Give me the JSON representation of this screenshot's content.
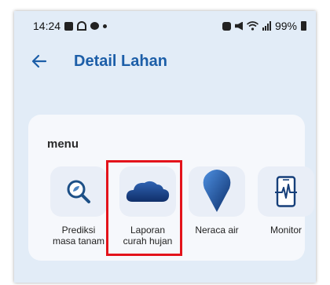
{
  "status_bar": {
    "time": "14:24",
    "battery": "99%"
  },
  "header": {
    "title": "Detail Lahan"
  },
  "menu": {
    "title": "menu",
    "items": [
      {
        "label": "Prediksi\nmasa tanam",
        "icon": "magnifier-leaf-icon"
      },
      {
        "label": "Laporan\ncurah hujan",
        "icon": "cloud-icon"
      },
      {
        "label": "Neraca air",
        "icon": "water-drop-icon"
      },
      {
        "label": "Monitor",
        "icon": "phone-pulse-icon"
      }
    ]
  },
  "colors": {
    "accent": "#1c5ea8",
    "highlight": "#e3131b",
    "background": "#e2ecf7"
  }
}
